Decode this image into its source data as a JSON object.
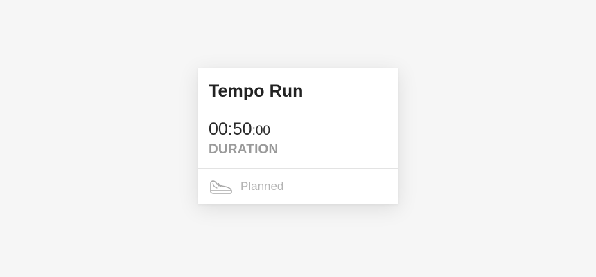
{
  "workout": {
    "title": "Tempo Run",
    "duration": {
      "main": "00:50",
      "seconds": ":00",
      "label": "DURATION"
    },
    "status": {
      "icon": "running-shoe-icon",
      "label": "Planned"
    }
  },
  "colors": {
    "background": "#f6f6f6",
    "card": "#ffffff",
    "title": "#222222",
    "label": "#9a9a9a",
    "status": "#b3b3b3"
  }
}
